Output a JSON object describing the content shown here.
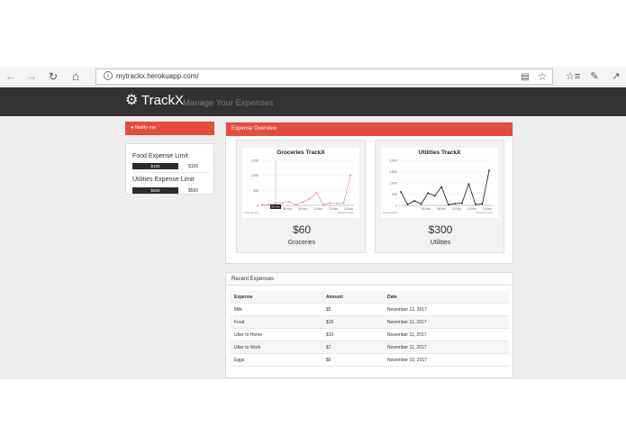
{
  "browser": {
    "url": "mytrackx.herokuapp.com/",
    "back_icon": "back-arrow-icon",
    "forward_icon": "forward-arrow-icon",
    "refresh_icon": "refresh-icon",
    "home_icon": "home-icon",
    "reading_icon": "reading-view-icon",
    "favorite_icon": "star-icon",
    "hub_icon": "favorites-hub-icon",
    "notes_icon": "pen-icon",
    "share_icon": "share-icon"
  },
  "header": {
    "brand": "TrackX",
    "tagline": "Manage Your Expenses",
    "background": "#333333"
  },
  "sidebar": {
    "notify_label": "Notify me",
    "limits": [
      {
        "label": "Food Expense Limit",
        "current": "$100",
        "max": "$150",
        "fraction": 0.667
      },
      {
        "label": "Utilities Expense Limit",
        "current": "$200",
        "max": "$500",
        "fraction": 0.4
      }
    ]
  },
  "overview": {
    "title": "Expense Overview",
    "accent": "#e64c3c",
    "charts": [
      {
        "title": "Groceries TrackX",
        "amount": "$60",
        "label": "Groceries",
        "line_color": "#f08080"
      },
      {
        "title": "Utilities TrackX",
        "amount": "$300",
        "label": "Utilities",
        "line_color": "#111111"
      }
    ]
  },
  "chart_data": [
    {
      "type": "line",
      "title": "Groceries TrackX",
      "y_ticks": [
        "0",
        "500",
        "1,000",
        "1,500"
      ],
      "ylim": [
        0,
        1500
      ],
      "x_ticks": [
        "06 Nov",
        "08 Nov",
        "10 Nov",
        "12 Nov",
        "14 Nov"
      ],
      "footer_left": "Final Version",
      "footer_right": "CanvasJS.com",
      "tooltip": "05 Nov",
      "series": [
        {
          "values": [
            20,
            30,
            60,
            80,
            120,
            30,
            110,
            220,
            420,
            20,
            80,
            60,
            80,
            1000
          ]
        }
      ]
    },
    {
      "type": "line",
      "title": "Utilities TrackX",
      "y_ticks": [
        "0",
        "500",
        "1,000",
        "1,500",
        "2,000"
      ],
      "ylim": [
        0,
        2000
      ],
      "x_ticks": [
        "06 Nov",
        "08 Nov",
        "10 Nov",
        "12 Nov",
        "14 Nov"
      ],
      "footer_left": "Final Version",
      "footer_right": "CanvasJS.com",
      "series": [
        {
          "values": [
            600,
            40,
            200,
            60,
            550,
            420,
            820,
            30,
            80,
            100,
            950,
            40,
            60,
            1550
          ]
        }
      ]
    }
  ],
  "recent": {
    "title": "Recent Expenses",
    "columns": [
      "Expense",
      "Amount",
      "Date"
    ],
    "rows": [
      {
        "expense": "Milk",
        "amount": "$5",
        "date": "November 12, 2017"
      },
      {
        "expense": "Food",
        "amount": "$15",
        "date": "November 11, 2017"
      },
      {
        "expense": "Uber to Home",
        "amount": "$10",
        "date": "November 11, 2017"
      },
      {
        "expense": "Uber to Work",
        "amount": "$7",
        "date": "November 11, 2017"
      },
      {
        "expense": "Eggs",
        "amount": "$6",
        "date": "November 10, 2017"
      }
    ]
  }
}
